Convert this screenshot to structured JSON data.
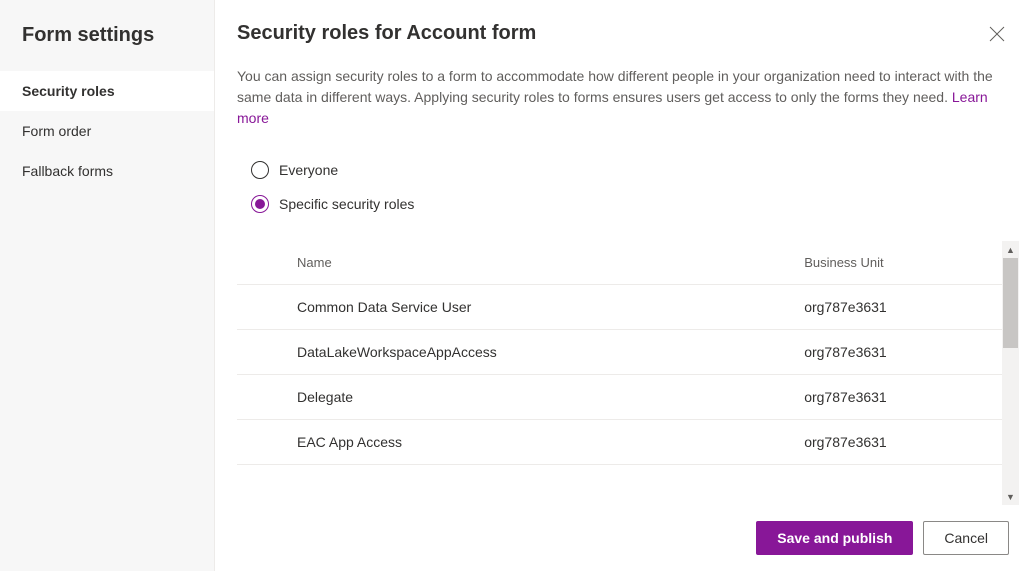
{
  "sidebar": {
    "title": "Form settings",
    "items": [
      {
        "label": "Security roles",
        "active": true
      },
      {
        "label": "Form order",
        "active": false
      },
      {
        "label": "Fallback forms",
        "active": false
      }
    ]
  },
  "main": {
    "title": "Security roles for Account form",
    "description_text": "You can assign security roles to a form to accommodate how different people in your organization need to interact with the same data in different ways. Applying security roles to forms ensures users get access to only the forms they need. ",
    "learn_more": "Learn more"
  },
  "radios": {
    "everyone": "Everyone",
    "specific": "Specific security roles",
    "selected": "specific"
  },
  "table": {
    "headers": {
      "name": "Name",
      "bu": "Business Unit"
    },
    "rows": [
      {
        "name": "Common Data Service User",
        "bu": "org787e3631"
      },
      {
        "name": "DataLakeWorkspaceAppAccess",
        "bu": "org787e3631"
      },
      {
        "name": "Delegate",
        "bu": "org787e3631"
      },
      {
        "name": "EAC App Access",
        "bu": "org787e3631"
      }
    ]
  },
  "footer": {
    "save": "Save and publish",
    "cancel": "Cancel"
  }
}
